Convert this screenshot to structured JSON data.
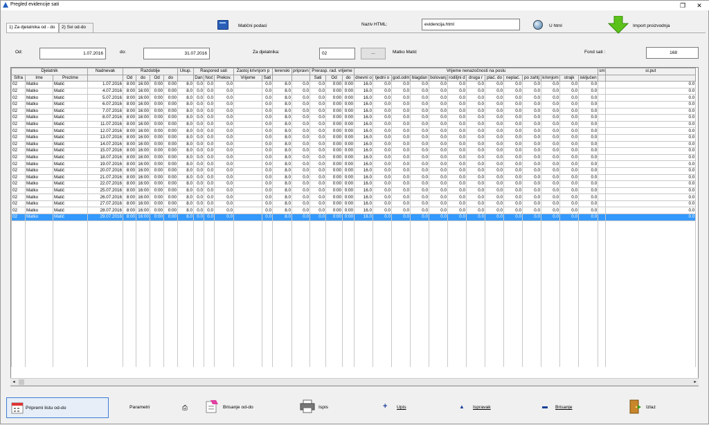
{
  "window": {
    "title": "Pregled evidencije sati"
  },
  "tabs": [
    {
      "label": "1) Za djelatnika od - do"
    },
    {
      "label": "2) Svi od-do"
    }
  ],
  "toolbar": {
    "maticni": "Matični podaci",
    "naziv_html_label": "Naziv HTML:",
    "naziv_html_value": "evidencija.html",
    "u_html": "U html",
    "import": "Import proizvodnja"
  },
  "filters": {
    "od_label": "Od:",
    "od_value": "1.07.2016",
    "do_label": "do:",
    "do_value": "31.07.2016",
    "djelatnik_label": "Za djelatnika:",
    "djelatnik_code": "02",
    "dots": "...",
    "djelatnik_name": "Matko Matić",
    "fond_label": "Fond sati :",
    "fond_value": "168"
  },
  "grid": {
    "groups": [
      "Djelatnik",
      "Nadnevak",
      "Razdoblje",
      "Ukup.",
      "Raspored sati",
      "Zastoj krivnjom p",
      "terenski",
      "pripravn",
      "Prerasp. rad. vrijeme",
      "Vrijeme nenazočnosti na poslu",
      "sm",
      "sl.put"
    ],
    "columns": [
      "Sifra",
      "Ime",
      "Prezime",
      "",
      "Od",
      "do",
      "Od",
      "do",
      "",
      "Dan",
      "Noć",
      "Prekov.",
      "Vrijeme",
      "Sati",
      "",
      "",
      "Sati",
      "Od",
      "do",
      "dnevni o",
      "tjedni o",
      "god.odm",
      "blagdan",
      "bolovanj",
      "rodiljni d",
      "druga r",
      "plać. do",
      "neplać.",
      "po zahtj",
      "krivnjom",
      "strajk",
      "isključen",
      "",
      ""
    ],
    "rows": [
      {
        "sifra": "02",
        "ime": "Matko",
        "prezime": "Matić",
        "datum": "1.07.2016"
      },
      {
        "sifra": "02",
        "ime": "Matko",
        "prezime": "Matić",
        "datum": "4.07.2016"
      },
      {
        "sifra": "02",
        "ime": "Matko",
        "prezime": "Matić",
        "datum": "5.07.2016"
      },
      {
        "sifra": "02",
        "ime": "Matko",
        "prezime": "Matić",
        "datum": "6.07.2016"
      },
      {
        "sifra": "02",
        "ime": "Matko",
        "prezime": "Matić",
        "datum": "7.07.2016"
      },
      {
        "sifra": "02",
        "ime": "Matko",
        "prezime": "Matić",
        "datum": "8.07.2016"
      },
      {
        "sifra": "02",
        "ime": "Matko",
        "prezime": "Matić",
        "datum": "11.07.2016"
      },
      {
        "sifra": "02",
        "ime": "Matko",
        "prezime": "Matić",
        "datum": "12.07.2016"
      },
      {
        "sifra": "02",
        "ime": "Matko",
        "prezime": "Matić",
        "datum": "13.07.2016"
      },
      {
        "sifra": "02",
        "ime": "Matko",
        "prezime": "Matić",
        "datum": "14.07.2016"
      },
      {
        "sifra": "02",
        "ime": "Matko",
        "prezime": "Matić",
        "datum": "15.07.2016"
      },
      {
        "sifra": "02",
        "ime": "Matko",
        "prezime": "Matić",
        "datum": "18.07.2016"
      },
      {
        "sifra": "02",
        "ime": "Matko",
        "prezime": "Matić",
        "datum": "19.07.2016"
      },
      {
        "sifra": "02",
        "ime": "Matko",
        "prezime": "Matić",
        "datum": "20.07.2016"
      },
      {
        "sifra": "02",
        "ime": "Matko",
        "prezime": "Matić",
        "datum": "21.07.2016"
      },
      {
        "sifra": "02",
        "ime": "Matko",
        "prezime": "Matić",
        "datum": "22.07.2016"
      },
      {
        "sifra": "02",
        "ime": "Matko",
        "prezime": "Matić",
        "datum": "25.07.2016"
      },
      {
        "sifra": "02",
        "ime": "Matko",
        "prezime": "Matić",
        "datum": "26.07.2016"
      },
      {
        "sifra": "02",
        "ime": "Matko",
        "prezime": "Matić",
        "datum": "27.07.2016"
      },
      {
        "sifra": "02",
        "ime": "Matko",
        "prezime": "Matić",
        "datum": "28.07.2016"
      },
      {
        "sifra": "02",
        "ime": "Matko",
        "prezime": "Matić",
        "datum": "29.07.2016"
      }
    ],
    "row_values": [
      "8:00",
      "16:00",
      "0:00",
      "0:00",
      "8.0",
      "0.0",
      "0.0",
      "0.0",
      "",
      "0.0",
      "8.0",
      "0.0",
      "0.0",
      "0:00",
      "0:00",
      "16.0",
      "0.0",
      "0.0",
      "0.0",
      "0.0",
      "0.0",
      "0.0",
      "0.0",
      "0.0",
      "0.0",
      "0.0",
      "0.0",
      "0.0",
      "",
      "0.0"
    ],
    "selected_row": 20
  },
  "bottom": {
    "pripremi": "Pripremi listu od-do",
    "parametri": "Parametri",
    "brisanje_od_do": "Brisanje od-do",
    "ispis": "Ispis",
    "upis": "Upis",
    "ispravak": "Ispravak",
    "brisanje": "Brisanje",
    "izlaz": "Izlaz"
  },
  "colors": {
    "selection": "#3399ff",
    "arrow": "#5cc21a",
    "book": "#2a5fb8"
  }
}
